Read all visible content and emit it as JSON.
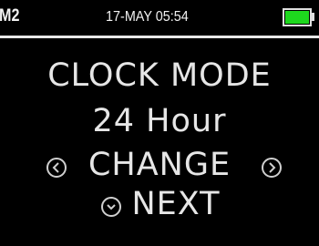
{
  "status": {
    "device_id": "M2",
    "datetime": "17-MAY 05:54",
    "battery_level": 1.0,
    "battery_color": "#1ed81e"
  },
  "menu": {
    "title": "CLOCK MODE",
    "value": "24 Hour",
    "change_label": "CHANGE",
    "next_label": "NEXT"
  },
  "icons": {
    "left": "chevron-left-icon",
    "right": "chevron-right-icon",
    "down": "chevron-down-icon"
  }
}
